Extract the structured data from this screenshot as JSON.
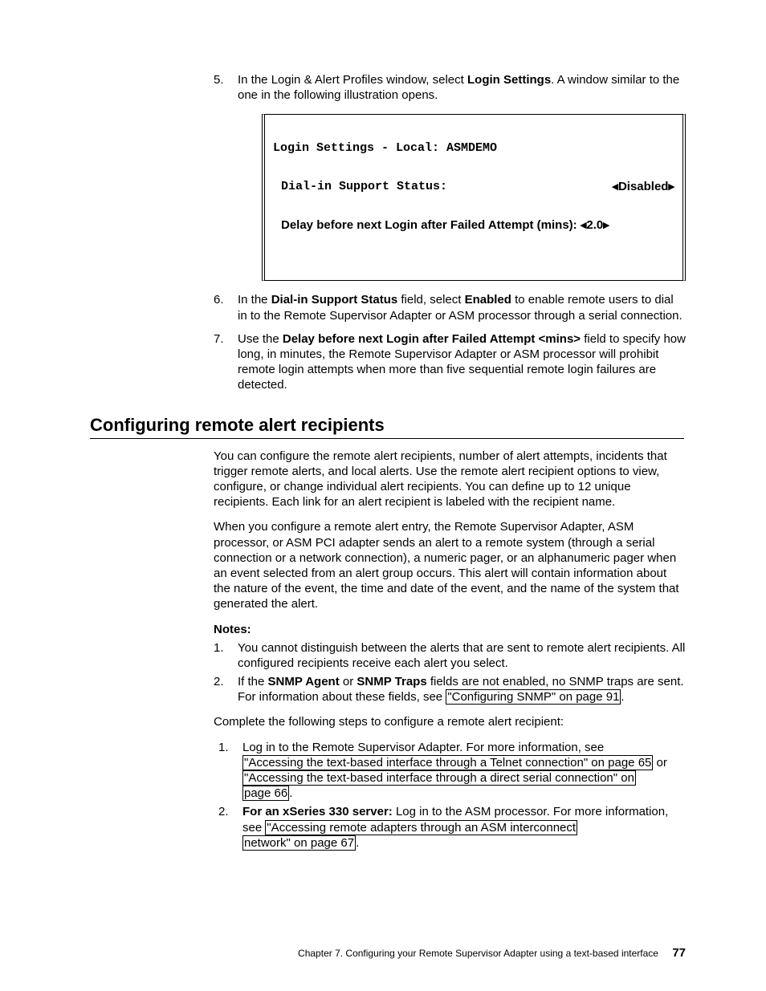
{
  "steps_a": {
    "n5": "5.",
    "s5_pre": "In the Login & Alert Profiles window, select ",
    "s5_b": "Login Settings",
    "s5_post": ". A window similar to the one in the following illustration opens.",
    "n6": "6.",
    "s6_a": "In the ",
    "s6_b1": "Dial-in Support Status",
    "s6_c": " field, select ",
    "s6_b2": "Enabled",
    "s6_d": " to enable remote users to dial in to the Remote Supervisor Adapter or ASM processor through a serial connection.",
    "n7": "7.",
    "s7_a": "Use the ",
    "s7_b": "Delay before next Login after Failed Attempt <mins>",
    "s7_c": " field to specify how long, in minutes, the Remote Supervisor Adapter or ASM processor will prohibit remote login attempts when more than five sequential remote login failures are detected."
  },
  "term": {
    "line1": "Login Settings - Local: ASMDEMO",
    "line2_l": "Dial-in Support Status:",
    "line2_r": "◂Disabled▸",
    "line3_l": "Delay before next Login after Failed Attempt (mins): ◂2.0▸"
  },
  "heading": "Configuring remote alert recipients",
  "p1": "You can configure the remote alert recipients, number of alert attempts, incidents that trigger remote alerts, and local alerts. Use the remote alert recipient options to view, configure, or change individual alert recipients. You can define up to 12 unique recipients. Each link for an alert recipient is labeled with the recipient name.",
  "p2": "When you configure a remote alert entry, the Remote Supervisor Adapter, ASM processor, or ASM PCI adapter sends an alert to a remote system (through a serial connection or a network connection), a numeric pager, or an alphanumeric pager when an event selected from an alert group occurs. This alert will contain information about the nature of the event, the time and date of the event, and the name of the system that generated the alert.",
  "notes_label": "Notes:",
  "notes": {
    "n1": "1.",
    "note1": "You cannot distinguish between the alerts that are sent to remote alert recipients. All configured recipients receive each alert you select.",
    "n2": "2.",
    "note2_a": "If the ",
    "note2_b1": "SNMP Agent",
    "note2_mid": " or ",
    "note2_b2": "SNMP Traps",
    "note2_c": " fields are not enabled, no SNMP traps are sent. For information about these fields, see ",
    "note2_link": "\"Configuring SNMP\" on page 91",
    "note2_end": "."
  },
  "p3": "Complete the following steps to configure a remote alert recipient:",
  "steps_b": {
    "n1": "1.",
    "s1_a": "Log in to the Remote Supervisor Adapter. For more information, see ",
    "s1_link1": "\"Accessing the text-based interface through a Telnet connection\" on page 65",
    "s1_mid": " or ",
    "s1_link2a": "\"Accessing the text-based interface through a direct serial connection\" on",
    "s1_link2b": "page 66",
    "s1_end": ".",
    "n2": "2.",
    "s2_b": "For an xSeries 330 server:",
    "s2_a": " Log in to the ASM processor. For more information, see ",
    "s2_link_a": "\"Accessing remote adapters through an ASM interconnect",
    "s2_link_b": "network\" on page 67",
    "s2_end": "."
  },
  "footer": {
    "text": "Chapter 7. Configuring your Remote Supervisor Adapter using a text-based interface",
    "page": "77"
  }
}
